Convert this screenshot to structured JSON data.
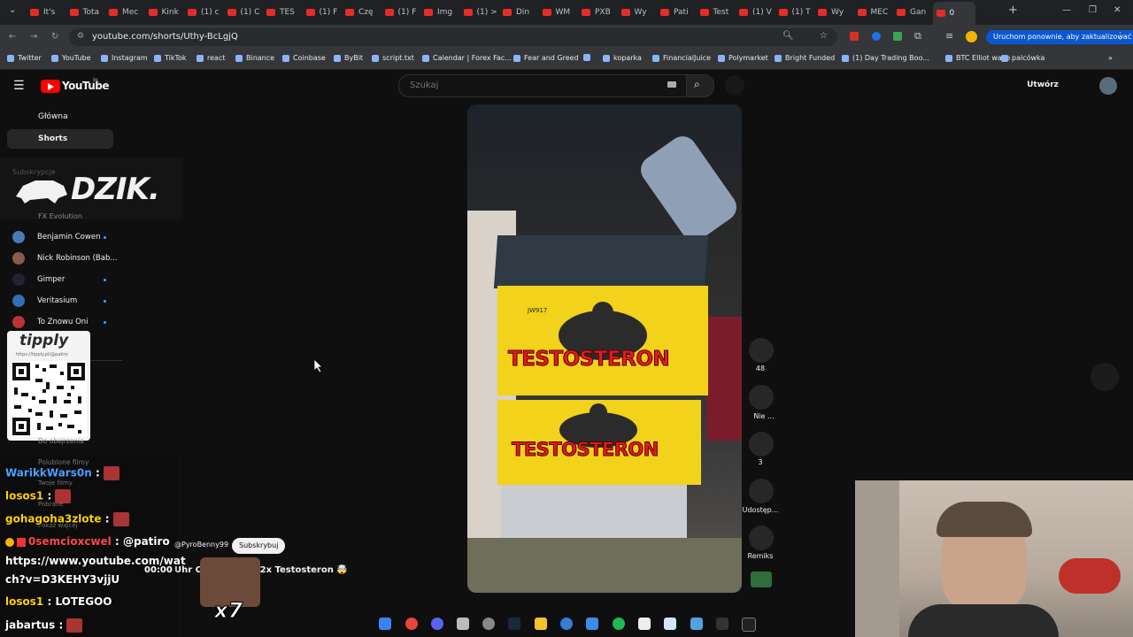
{
  "browser": {
    "tabs": [
      {
        "label": "It's"
      },
      {
        "label": "Tota"
      },
      {
        "label": "Mec"
      },
      {
        "label": "Kink"
      },
      {
        "label": "(1) c"
      },
      {
        "label": "(1) C"
      },
      {
        "label": "TES"
      },
      {
        "label": "(1) F"
      },
      {
        "label": "Czę"
      },
      {
        "label": "(1) F"
      },
      {
        "label": "Img"
      },
      {
        "label": "(1) >"
      },
      {
        "label": "Din"
      },
      {
        "label": "WM"
      },
      {
        "label": "PXB"
      },
      {
        "label": "Wy"
      },
      {
        "label": "Pati"
      },
      {
        "label": "Test"
      },
      {
        "label": "(1) V"
      },
      {
        "label": "(1) T"
      },
      {
        "label": "Wy"
      },
      {
        "label": "MEC"
      },
      {
        "label": "Gan"
      },
      {
        "label": "0"
      }
    ],
    "new_tab": "+",
    "url": "youtube.com/shorts/Uthy-BcLgjQ",
    "update_button": "Uruchom ponownie, aby zaktualizować",
    "bookmarks": [
      "Twitter",
      "YouTube",
      "Instagram",
      "TikTok",
      "react",
      "Binance",
      "Coinbase",
      "ByBit",
      "script.txt",
      "Calendar | Forex Fac...",
      "Fear and Greed",
      "",
      "koparka",
      "FinancialJuice",
      "Polymarket",
      "Bright Funded",
      "(1) Day Trading Boo...",
      "BTC Elliot wave",
      "palcówka"
    ]
  },
  "youtube": {
    "logo_text": "YouTube",
    "region": "PL",
    "search_placeholder": "Szukaj",
    "create_button": "Utwórz",
    "sidebar": {
      "home": "Główna",
      "shorts": "Shorts",
      "subscriptions_header": "Subskrypcje",
      "channels": [
        {
          "name": "FX Evolution"
        },
        {
          "name": "Benjamin Cowen"
        },
        {
          "name": "Nick Robinson (Bab..."
        },
        {
          "name": "Gimper"
        },
        {
          "name": "Veritasium"
        },
        {
          "name": "To Znowu Oni"
        }
      ],
      "you_items": [
        "Do obejrzenia",
        "Polubione filmy",
        "Twoje filmy",
        "Pobrane",
        "Pokaż więcej"
      ]
    },
    "short": {
      "product_label_top": "TESTOSTERON",
      "product_label_bottom": "TESTOSTERON",
      "product_code": "JW917",
      "channel": "@PyroBenny99",
      "subscribe": "Subskrybuj",
      "title": "Uhr Cr... ...lation 2x Testosteron 🤯"
    },
    "actions": [
      {
        "label": "48"
      },
      {
        "label": "Nie ..."
      },
      {
        "label": "3"
      },
      {
        "label": "Udostęp..."
      },
      {
        "label": "Remiks"
      }
    ]
  },
  "overlay": {
    "dzik_logo": "DZIK.",
    "tipply_text": "tipply",
    "tipply_url": "https://tipply.pl/@patiro",
    "timer": "00:00",
    "multiplier": "x7",
    "chat": [
      {
        "user": "WarikkWars0n",
        "sep": ":",
        "text": "",
        "color": "#4aa3ff"
      },
      {
        "user": "losos1",
        "sep": ":",
        "text": "",
        "color": "#ffd200"
      },
      {
        "user": "gohagoha3zlote",
        "sep": ":",
        "text": "",
        "color": "#ffd200"
      },
      {
        "user": "0semcioxcwel",
        "sep": ":",
        "text": "@patiro",
        "color": "#ff4a4a"
      },
      {
        "user": "",
        "sep": "",
        "text": "https://www.youtube.com/wat",
        "color": "#fff"
      },
      {
        "user": "",
        "sep": "",
        "text": "ch?v=D3KEHY3vjjU",
        "color": "#fff"
      },
      {
        "user": "losos1",
        "sep": ":",
        "text": "LOTEGOO",
        "color": "#ffd200"
      },
      {
        "user": "jabartus",
        "sep": ":",
        "text": "",
        "color": "#fff"
      }
    ]
  },
  "colors": {
    "yt_red": "#ff0000",
    "bg": "#0f0f0f",
    "chrome_dark": "#202124"
  }
}
